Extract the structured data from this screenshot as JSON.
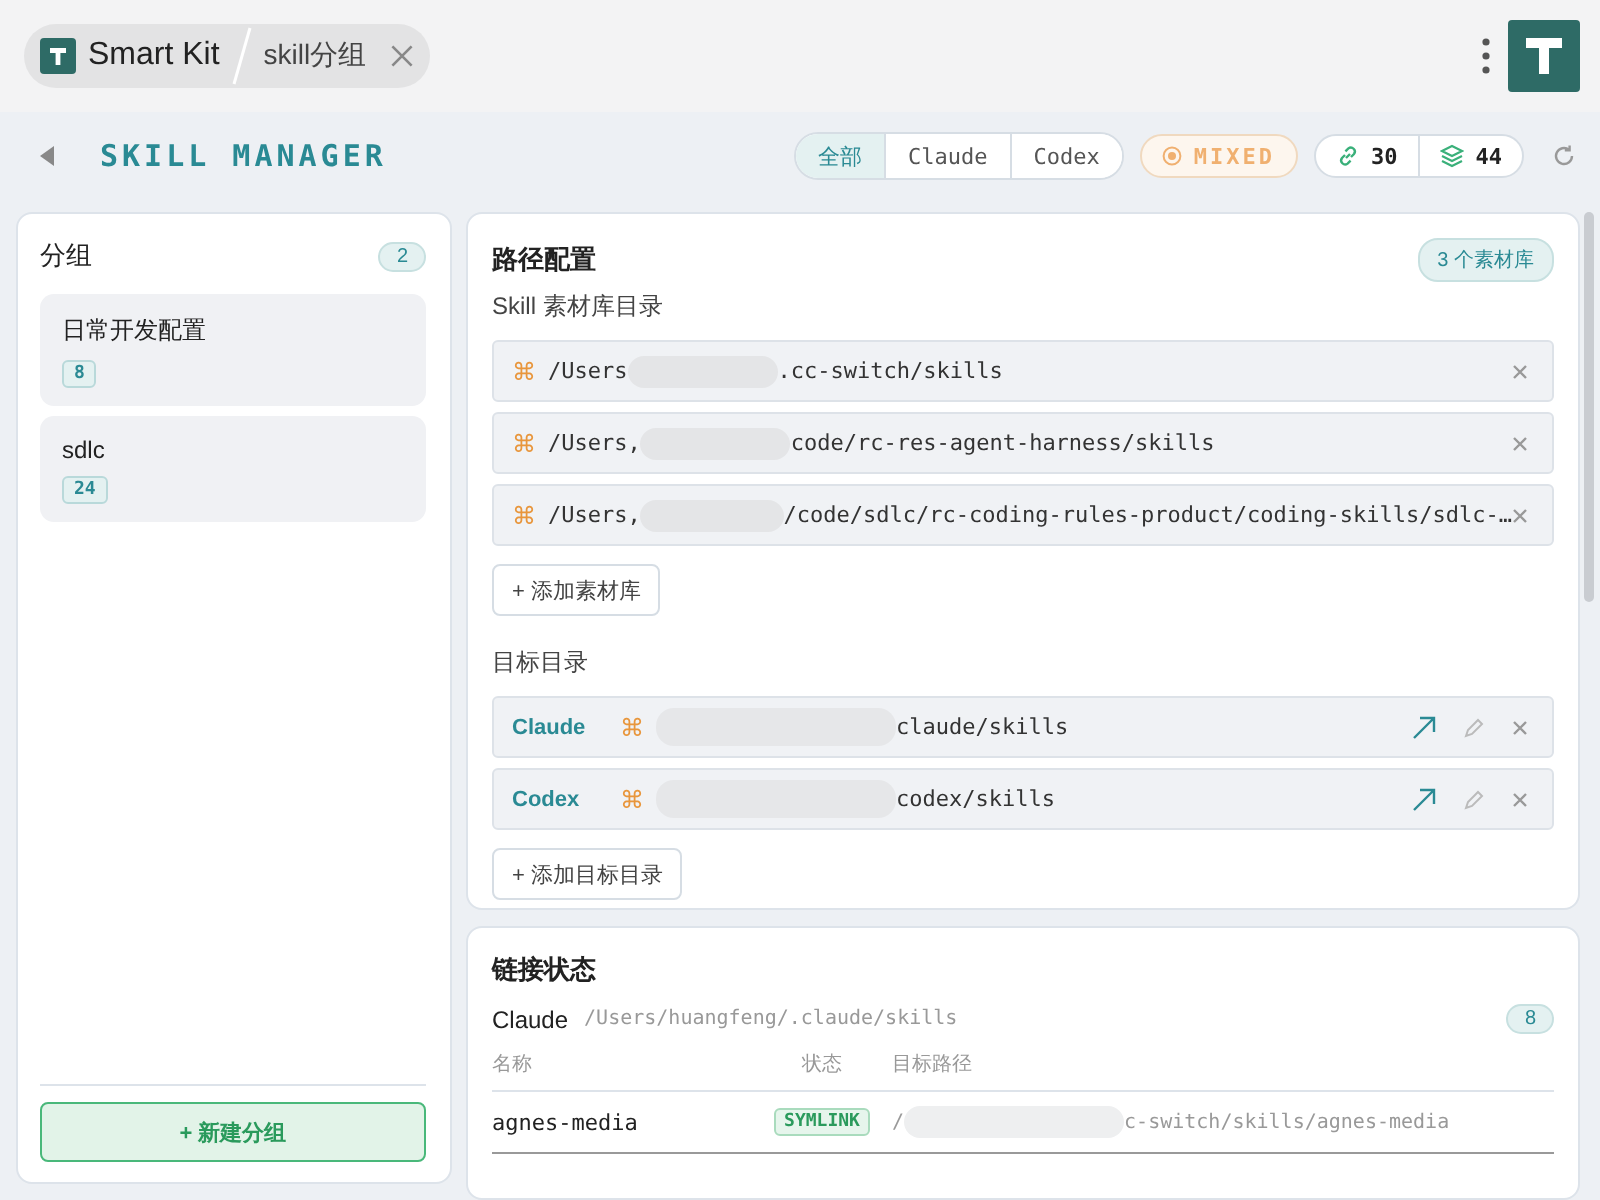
{
  "app_tab": {
    "name": "Smart Kit",
    "page": "skill分组"
  },
  "header": {
    "title": "SKILL MANAGER",
    "filters": [
      {
        "label": "全部",
        "selected": true
      },
      {
        "label": "Claude",
        "selected": false
      },
      {
        "label": "Codex",
        "selected": false
      }
    ],
    "mode": "MIXED",
    "link_count": "30",
    "layer_count": "44"
  },
  "groups": {
    "title": "分组",
    "count": "2",
    "items": [
      {
        "name": "日常开发配置",
        "count": "8"
      },
      {
        "name": "sdlc",
        "count": "24"
      }
    ],
    "new_button": "+ 新建分组"
  },
  "paths": {
    "title": "路径配置",
    "badge": "3 个素材库",
    "library_label": "Skill 素材库目录",
    "libraries": [
      {
        "icon": "⌘",
        "prefix": "/Users",
        "suffix": ".cc-switch/skills"
      },
      {
        "icon": "⌘",
        "prefix": "/Users,",
        "suffix": "code/rc-res-agent-harness/skills"
      },
      {
        "icon": "⌘",
        "prefix": "/Users,",
        "suffix": "/code/sdlc/rc-coding-rules-product/coding-skills/sdlc-…"
      }
    ],
    "add_library": "+ 添加素材库",
    "target_label": "目标目录",
    "targets": [
      {
        "name": "Claude",
        "icon": "⌘",
        "suffix": "claude/skills"
      },
      {
        "name": "Codex",
        "icon": "⌘",
        "suffix": "codex/skills"
      }
    ],
    "add_target": "+ 添加目标目录"
  },
  "links": {
    "title": "链接状态",
    "agent": "Claude",
    "path": "/Users/huangfeng/.claude/skills",
    "count": "8",
    "columns": [
      "名称",
      "状态",
      "目标路径"
    ],
    "rows": [
      {
        "name": "agnes-media",
        "status": "SYMLINK",
        "target_prefix": "/",
        "target_suffix": "c-switch/skills/agnes-media"
      }
    ]
  }
}
